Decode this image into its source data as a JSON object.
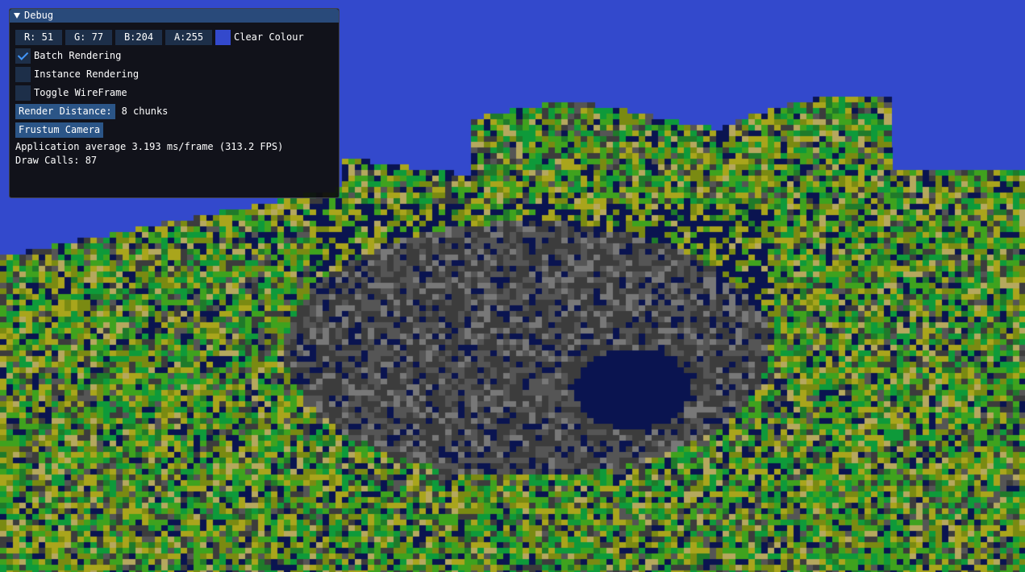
{
  "window": {
    "title": "Debug",
    "clear_colour": {
      "r_label": "R: 51",
      "g_label": "G: 77",
      "b_label": "B:204",
      "a_label": "A:255",
      "swatch_hex": "#3349cc",
      "label": "Clear Colour"
    },
    "checkboxes": [
      {
        "label": "Batch Rendering",
        "checked": true
      },
      {
        "label": "Instance Rendering",
        "checked": false
      },
      {
        "label": "Toggle WireFrame",
        "checked": false
      }
    ],
    "render_distance": {
      "button_label": "Render Distance:",
      "value": "8 chunks"
    },
    "frustum_button": "Frustum Camera",
    "stats": {
      "frame_time": "Application average 3.193 ms/frame (313.2 FPS)",
      "draw_calls": "Draw Calls: 87"
    }
  },
  "scene": {
    "sky_color": "#3349cc",
    "palette": [
      "#0a1450",
      "#3c3c3c",
      "#555555",
      "#787878",
      "#0e9a3a",
      "#3fa21e",
      "#7a8a12",
      "#a9a51c",
      "#b5a85e",
      "#1f7a2a"
    ]
  }
}
